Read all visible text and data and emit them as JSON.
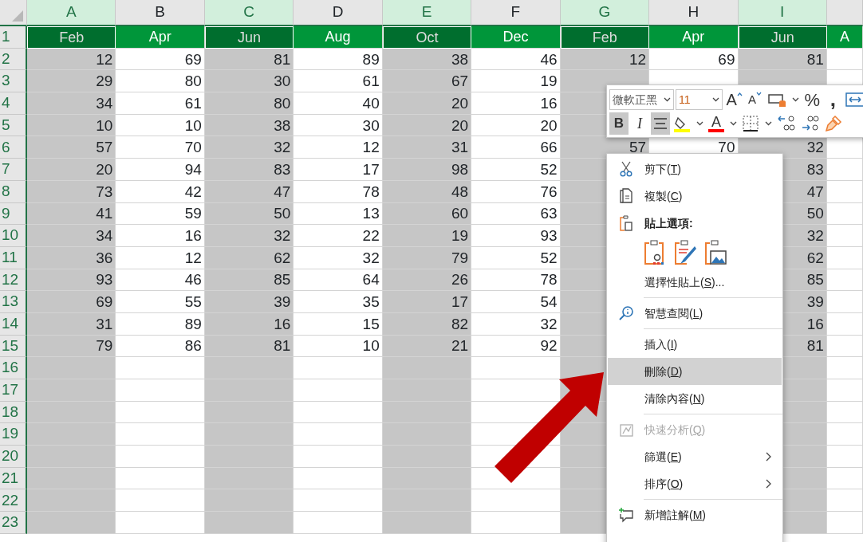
{
  "columns": [
    {
      "letter": "A",
      "selected": true
    },
    {
      "letter": "B",
      "selected": false
    },
    {
      "letter": "C",
      "selected": true
    },
    {
      "letter": "D",
      "selected": false
    },
    {
      "letter": "E",
      "selected": true
    },
    {
      "letter": "F",
      "selected": false
    },
    {
      "letter": "G",
      "selected": true
    },
    {
      "letter": "H",
      "selected": false
    },
    {
      "letter": "I",
      "selected": true
    },
    {
      "selected": false
    }
  ],
  "rows": [
    {
      "number": "1",
      "kind": "header",
      "cells": [
        "Feb",
        "Apr",
        "Jun",
        "Aug",
        "Oct",
        "Dec",
        "Feb",
        "Apr",
        "Jun",
        "A"
      ]
    },
    {
      "number": "2",
      "kind": "data",
      "cells": [
        "12",
        "69",
        "81",
        "89",
        "38",
        "46",
        "12",
        "69",
        "81",
        null
      ]
    },
    {
      "number": "3",
      "kind": "data",
      "cells": [
        "29",
        "80",
        "30",
        "61",
        "67",
        "19",
        null,
        null,
        null,
        null
      ]
    },
    {
      "number": "4",
      "kind": "data",
      "cells": [
        "34",
        "61",
        "80",
        "40",
        "20",
        "16",
        null,
        null,
        null,
        null
      ]
    },
    {
      "number": "5",
      "kind": "data",
      "cells": [
        "10",
        "10",
        "38",
        "30",
        "20",
        "20",
        null,
        null,
        null,
        null
      ]
    },
    {
      "number": "6",
      "kind": "data",
      "cells": [
        "57",
        "70",
        "32",
        "12",
        "31",
        "66",
        "57",
        "70",
        "32",
        null
      ]
    },
    {
      "number": "7",
      "kind": "data",
      "cells": [
        "20",
        "94",
        "83",
        "17",
        "98",
        "52",
        null,
        null,
        "83",
        null
      ]
    },
    {
      "number": "8",
      "kind": "data",
      "cells": [
        "73",
        "42",
        "47",
        "78",
        "48",
        "76",
        null,
        null,
        "47",
        null
      ]
    },
    {
      "number": "9",
      "kind": "data",
      "cells": [
        "41",
        "59",
        "50",
        "13",
        "60",
        "63",
        null,
        null,
        "50",
        null
      ]
    },
    {
      "number": "10",
      "kind": "data",
      "cells": [
        "34",
        "16",
        "32",
        "22",
        "19",
        "93",
        null,
        null,
        "32",
        null
      ]
    },
    {
      "number": "11",
      "kind": "data",
      "cells": [
        "36",
        "12",
        "62",
        "32",
        "79",
        "52",
        null,
        null,
        "62",
        null
      ]
    },
    {
      "number": "12",
      "kind": "data",
      "cells": [
        "93",
        "46",
        "85",
        "64",
        "26",
        "78",
        null,
        null,
        "85",
        null
      ]
    },
    {
      "number": "13",
      "kind": "data",
      "cells": [
        "69",
        "55",
        "39",
        "35",
        "17",
        "54",
        null,
        null,
        "39",
        null
      ]
    },
    {
      "number": "14",
      "kind": "data",
      "cells": [
        "31",
        "89",
        "16",
        "15",
        "82",
        "32",
        null,
        null,
        "16",
        null
      ]
    },
    {
      "number": "15",
      "kind": "data",
      "cells": [
        "79",
        "86",
        "81",
        "10",
        "21",
        "92",
        null,
        null,
        "81",
        null
      ]
    },
    {
      "number": "16",
      "kind": "data",
      "cells": []
    },
    {
      "number": "17",
      "kind": "data",
      "cells": []
    },
    {
      "number": "18",
      "kind": "data",
      "cells": []
    },
    {
      "number": "19",
      "kind": "data",
      "cells": []
    },
    {
      "number": "20",
      "kind": "data",
      "cells": []
    },
    {
      "number": "21",
      "kind": "data",
      "cells": []
    },
    {
      "number": "22",
      "kind": "data",
      "cells": []
    },
    {
      "number": "23",
      "kind": "data",
      "cells": []
    }
  ],
  "mini_toolbar": {
    "font": "微軟正黑",
    "size": "11",
    "row1": [
      {
        "kind": "grow",
        "label": "A"
      },
      {
        "kind": "shrink",
        "label": "A"
      },
      {
        "kind": "number-format"
      },
      {
        "kind": "caret"
      },
      {
        "kind": "percent",
        "label": "%"
      },
      {
        "kind": "comma",
        "label": ","
      },
      {
        "kind": "merge"
      }
    ],
    "row2": [
      {
        "kind": "bold",
        "label": "B",
        "pressed": true
      },
      {
        "kind": "italic",
        "label": "I",
        "pressed": false
      },
      {
        "kind": "center",
        "pressed": true
      },
      {
        "kind": "fill"
      },
      {
        "kind": "caret"
      },
      {
        "kind": "font-color",
        "label": "A"
      },
      {
        "kind": "caret"
      },
      {
        "kind": "borders"
      },
      {
        "kind": "caret"
      },
      {
        "kind": "inc-decimal"
      },
      {
        "kind": "dec-decimal"
      },
      {
        "kind": "painter"
      }
    ]
  },
  "context_menu": [
    {
      "kind": "cut",
      "before": "剪下(",
      "key": "T",
      "after": ")",
      "selected": false
    },
    {
      "kind": "copy",
      "before": "複製(",
      "key": "C",
      "after": ")",
      "selected": false
    },
    {
      "kind": "paste-header",
      "before": "貼上選項:"
    },
    {
      "kind": "paste-options",
      "options": [
        {
          "kind": "values"
        },
        {
          "kind": "formatting"
        },
        {
          "kind": "picture"
        }
      ]
    },
    {
      "kind": "plain",
      "before": "選擇性貼上(",
      "key": "S",
      "after": ")...",
      "selected": false
    },
    {
      "kind": "separator"
    },
    {
      "kind": "lookup",
      "before": "智慧查閱(",
      "key": "L",
      "after": ")",
      "selected": false
    },
    {
      "kind": "separator"
    },
    {
      "kind": "plain",
      "before": "插入(",
      "key": "I",
      "after": ")",
      "selected": false
    },
    {
      "kind": "plain",
      "before": "刪除(",
      "key": "D",
      "after": ")",
      "selected": true
    },
    {
      "kind": "plain",
      "before": "清除內容(",
      "key": "N",
      "after": ")",
      "selected": false
    },
    {
      "kind": "separator"
    },
    {
      "kind": "analysis",
      "before": "快速分析(",
      "key": "Q",
      "after": ")",
      "selected": false,
      "disabled": true
    },
    {
      "kind": "plain",
      "before": "篩選(",
      "key": "E",
      "after": ")",
      "selected": false,
      "submenu": true
    },
    {
      "kind": "plain",
      "before": "排序(",
      "key": "O",
      "after": ")",
      "selected": false,
      "submenu": true
    },
    {
      "kind": "separator"
    },
    {
      "kind": "comment",
      "before": "新增註解(",
      "key": "M",
      "after": ")",
      "selected": false
    }
  ],
  "annotation": {
    "kind": "arrow",
    "color": "#c00000"
  }
}
